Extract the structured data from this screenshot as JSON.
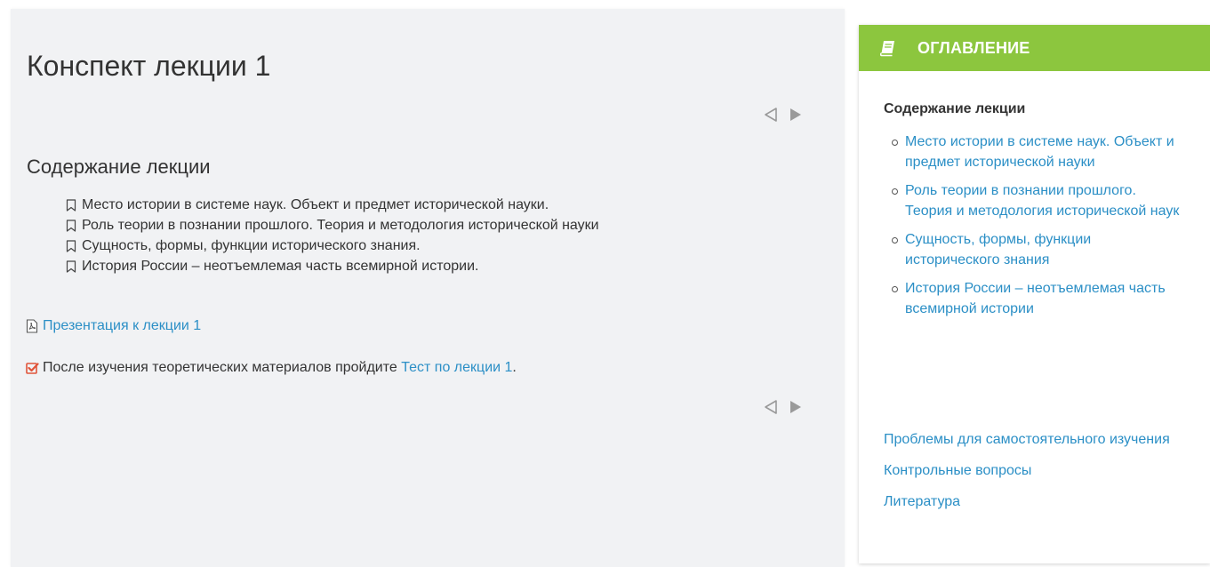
{
  "main": {
    "title": "Конспект лекции 1",
    "section_heading": "Содержание лекции",
    "topics": [
      "Место истории в системе наук. Объект и предмет исторической науки.",
      "Роль теории в познании прошлого. Теория и методология исторической науки",
      "Сущность, формы, функции исторического знания.",
      "История России – неотъемлемая часть всемирной истории."
    ],
    "presentation_link": "Презентация к лекции 1",
    "quiz_text": "После изучения теоретических материалов пройдите",
    "quiz_link": "Тест по лекции 1",
    "quiz_suffix": ".",
    "icons": {
      "topic": "bookmark-icon",
      "presentation": "pdf-icon",
      "quiz": "checkbox-icon",
      "prev": "prev-arrow-icon",
      "next": "next-arrow-icon"
    }
  },
  "toc": {
    "header_title": "ОГЛАВЛЕНИЕ",
    "header_icon": "book-icon",
    "section_title": "Содержание лекции",
    "subitems": [
      "Место истории в системе наук. Объект и предмет исторической науки",
      "Роль теории в познании прошлого. Теория и методология исторической наук",
      "Сущность, формы, функции исторического знания",
      "История России – неотъемлемая часть всемирной истории"
    ],
    "toplinks": [
      "Проблемы для самостоятельного изучения",
      "Контрольные вопросы",
      "Литература"
    ]
  },
  "colors": {
    "accent_green": "#8cc63e",
    "link_blue": "#2b8fc6",
    "quiz_icon_red": "#e0543a",
    "panel_bg": "#f1f2f4"
  }
}
